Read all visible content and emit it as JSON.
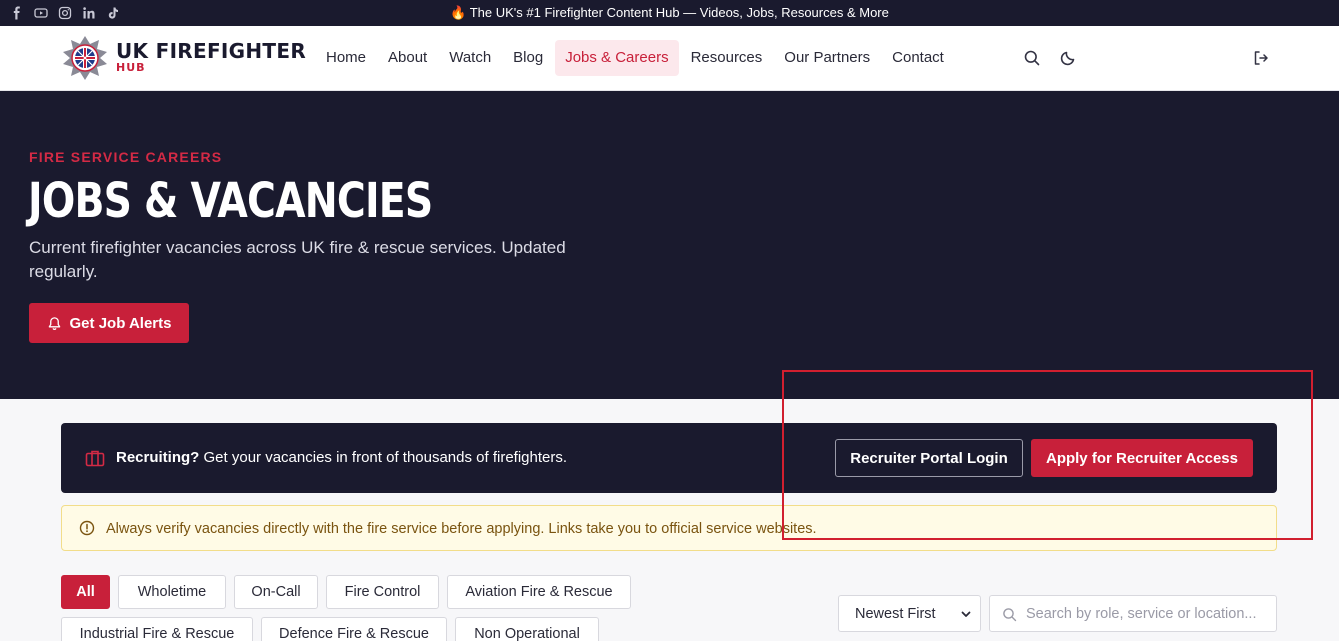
{
  "topbar": {
    "social_icons": [
      "facebook-icon",
      "youtube-icon",
      "instagram-icon",
      "linkedin-icon",
      "tiktok-icon"
    ],
    "announcement": "🔥 The UK's #1 Firefighter Content Hub — Videos, Jobs, Resources & More"
  },
  "nav": {
    "brand_main": "UK FIREFIGHTER",
    "brand_sub": "HUB",
    "items": [
      {
        "label": "Home"
      },
      {
        "label": "About"
      },
      {
        "label": "Watch"
      },
      {
        "label": "Blog"
      },
      {
        "label": "Jobs & Careers",
        "active": true
      },
      {
        "label": "Resources"
      },
      {
        "label": "Our Partners"
      },
      {
        "label": "Contact"
      }
    ],
    "icons": [
      "search-icon",
      "moon-icon",
      "logout-icon"
    ]
  },
  "hero": {
    "eyebrow": "FIRE SERVICE CAREERS",
    "title": "JOBS & VACANCIES",
    "description": "Current firefighter vacancies across UK fire & rescue services. Updated regularly.",
    "alerts_button": "Get Job Alerts"
  },
  "recruit": {
    "bold": "Recruiting?",
    "text": " Get your vacancies in front of thousands of firefighters.",
    "portal_button": "Recruiter Portal Login",
    "apply_button": "Apply for Recruiter Access"
  },
  "warning": {
    "text": "Always verify vacancies directly with the fire service before applying. Links take you to official service websites."
  },
  "filters": {
    "row1": [
      "All",
      "Wholetime",
      "On-Call",
      "Fire Control",
      "Aviation Fire & Rescue"
    ],
    "row2": [
      "Industrial Fire & Rescue",
      "Defence Fire & Rescue",
      "Non Operational"
    ],
    "active": "All"
  },
  "sort": {
    "selected": "Newest First"
  },
  "search": {
    "placeholder": "Search by role, service or location..."
  },
  "colors": {
    "accent": "#c8203a",
    "dark": "#1a1a2e",
    "warning_bg": "#fffbe6"
  }
}
